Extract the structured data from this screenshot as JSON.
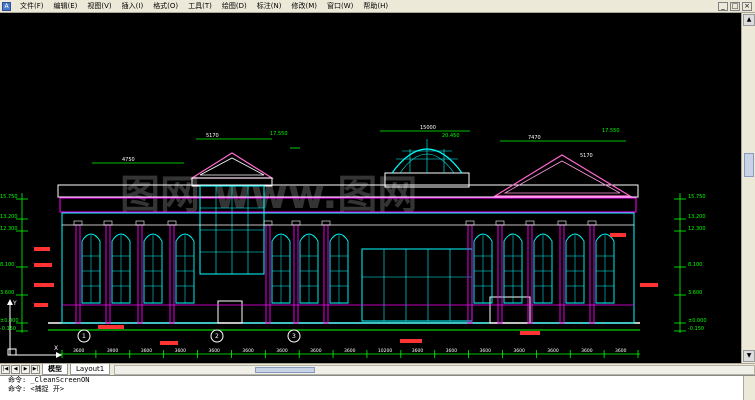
{
  "menu": {
    "items": [
      "文件(F)",
      "编辑(E)",
      "视图(V)",
      "插入(I)",
      "格式(O)",
      "工具(T)",
      "绘图(D)",
      "标注(N)",
      "修改(M)",
      "窗口(W)",
      "帮助(H)"
    ]
  },
  "window_controls": [
    "_",
    "□",
    "×"
  ],
  "drawing": {
    "watermark": "图网 www.图网",
    "top_dims": [
      "5170",
      "4750",
      "15000",
      "7470",
      "5170"
    ],
    "top_level_marks": [
      "17.550",
      "20.450",
      "17.550"
    ],
    "left_levels": [
      "15.750",
      "13.200",
      "12.300",
      "8.100",
      "3.600",
      "±0.000",
      "-0.150"
    ],
    "right_levels": [
      "15.750",
      "13.200",
      "12.300",
      "8.100",
      "3.600",
      "±0.000",
      "-0.150"
    ],
    "grid_bubbles": [
      "1",
      "2",
      "3"
    ],
    "bottom_dims": [
      "3600",
      "3900",
      "3600",
      "3600",
      "3600",
      "3600",
      "3600",
      "3600",
      "3600",
      "10200",
      "3600",
      "3600",
      "3600",
      "3600",
      "3600",
      "3600",
      "3600"
    ],
    "ucs_label": "Y",
    "x_label": "X"
  },
  "tabs": {
    "items": [
      "模型",
      "Layout1"
    ],
    "active": 0
  },
  "command": {
    "lines": [
      "命令: _CleanScreenON",
      "命令: <捕捉 开>"
    ]
  }
}
